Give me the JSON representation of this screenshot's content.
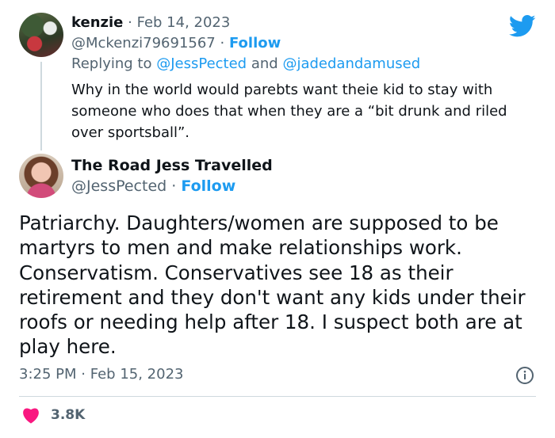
{
  "reply": {
    "author_name": "kenzie",
    "separator": "·",
    "date": "Feb 14, 2023",
    "handle": "@Mckenzi79691567",
    "follow_label": "Follow",
    "replying_prefix": "Replying to",
    "reply_to_1": "@JessPected",
    "reply_to_and": "and",
    "reply_to_2": "@jadedandamused",
    "text": "Why in the world would parebts want theie kid to stay with someone who does that when they are a “bit drunk and riled over sportsball”."
  },
  "main": {
    "author_name": "The Road Jess Travelled",
    "handle": "@JessPected",
    "separator": "·",
    "follow_label": "Follow",
    "text": "Patriarchy. Daughters/women are supposed to be martyrs to men and make relationships work. Conservatism. Conservatives see 18 as their retirement and they don't want any kids under their roofs or needing help after 18. I suspect both are at play here.",
    "time": "3:25 PM",
    "date": "Feb 15, 2023",
    "likes": "3.8K"
  },
  "icons": {
    "brand": "twitter-bird-icon",
    "info": "info-icon",
    "like": "heart-icon"
  },
  "colors": {
    "link": "#1d9bf0",
    "muted": "#536471",
    "heart": "#f91880",
    "text": "#0f1419"
  }
}
